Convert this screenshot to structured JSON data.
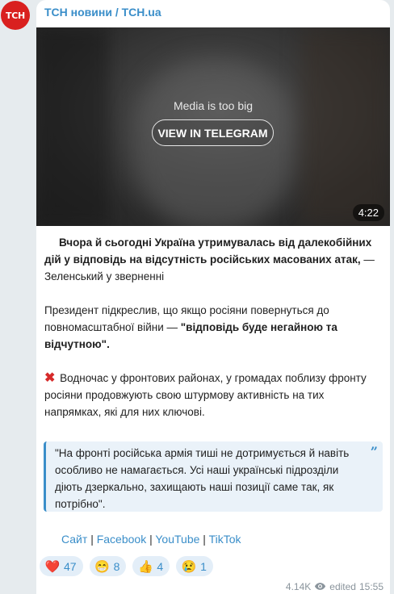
{
  "channel": {
    "avatar_text": "ТСН",
    "name": "ТСН новини / ТСН.ua"
  },
  "media": {
    "notice": "Media is too big",
    "button_label": "VIEW IN TELEGRAM",
    "duration": "4:22"
  },
  "post": {
    "p1_bold": "Вчора й сьогодні Україна утримувалась від далекобійних дій у відповідь на відсутність російських масованих атак,",
    "p1_rest": " — Зеленський у зверненні",
    "p2_plain": "Президент підкреслив, що якщо росіяни повернуться до повномасштабної війни — ",
    "p2_bold": "\"відповідь буде негайною та відчутною\".",
    "p3_icon": "cross-mark",
    "p3_text": " Водночас у фронтових районах, у громадах поблизу фронту росіяни продовжують свою штурмову активність на тих напрямках, які для них ключові.",
    "quote": "\"На фронті російська армія тиші не дотримується й навіть особливо не намагається. Усі наші українські підрозділи діють дзеркально, захищають наші позиції саме так, як потрібно\"."
  },
  "links": [
    {
      "label": "Сайт"
    },
    {
      "label": "Facebook"
    },
    {
      "label": "YouTube"
    },
    {
      "label": "TikTok"
    }
  ],
  "link_separator": "|",
  "reactions": [
    {
      "emoji": "❤️",
      "icon": "red-heart",
      "count": "47"
    },
    {
      "emoji": "😁",
      "icon": "grinning-face",
      "count": "8"
    },
    {
      "emoji": "👍",
      "icon": "thumbs-up",
      "count": "4"
    },
    {
      "emoji": "😢",
      "icon": "crying-face",
      "count": "1"
    }
  ],
  "footer": {
    "views": "4.14K",
    "edited": "edited",
    "time": "15:55"
  },
  "colors": {
    "accent": "#3a8ec9",
    "avatar_bg": "#d9201f"
  }
}
